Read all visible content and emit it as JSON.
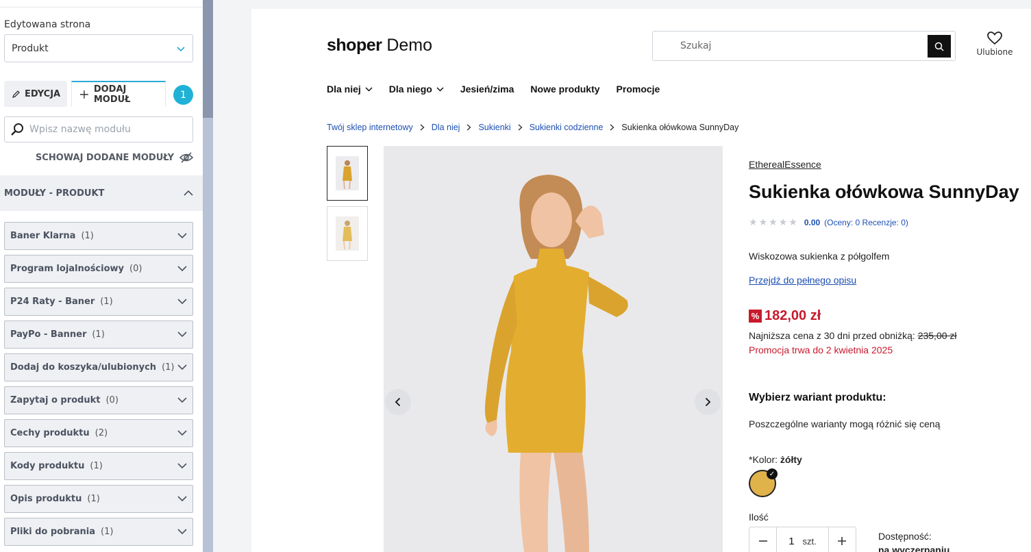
{
  "sidebar": {
    "edited_page_label": "Edytowana strona",
    "edited_page_value": "Produkt",
    "tab_edit": "EDYCJA",
    "tab_add_module": "DODAJ MODUŁ",
    "step_badge": "1",
    "search_placeholder": "Wpisz nazwę modułu",
    "hide_added": "SCHOWAJ DODANE MODUŁY",
    "modules_header": "MODUŁY - PRODUKT",
    "modules": [
      {
        "name": "Baner Klarna",
        "count": "(1)"
      },
      {
        "name": "Program lojalnościowy",
        "count": "(0)"
      },
      {
        "name": "P24 Raty - Baner",
        "count": "(1)"
      },
      {
        "name": "PayPo - Banner",
        "count": "(1)"
      },
      {
        "name": "Dodaj do koszyka/ulubionych",
        "count": "(1)"
      },
      {
        "name": "Zapytaj o produkt",
        "count": "(0)"
      },
      {
        "name": "Cechy produktu",
        "count": "(2)"
      },
      {
        "name": "Kody produktu",
        "count": "(1)"
      },
      {
        "name": "Opis produktu",
        "count": "(1)"
      },
      {
        "name": "Pliki do pobrania",
        "count": "(1)"
      }
    ]
  },
  "shop": {
    "logo_bold": "shoper",
    "logo_rest": "Demo",
    "search_placeholder": "Szukaj",
    "favorites_label": "Ulubione",
    "nav": [
      "Dla niej",
      "Dla niego",
      "Jesień/zima",
      "Nowe produkty",
      "Promocje"
    ],
    "breadcrumbs": [
      "Twój sklep internetowy",
      "Dla niej",
      "Sukienki",
      "Sukienki codzienne",
      "Sukienka ołówkowa SunnyDay"
    ]
  },
  "product": {
    "brand": "EtherealEssence",
    "title": "Sukienka ołówkowa SunnyDay",
    "rating_score": "0.00",
    "rating_counts": "(Oceny: 0 Recenzje: 0)",
    "short_description": "Wiskozowa sukienka z półgolfem",
    "full_description_link": "Przejdź do pełnego opisu",
    "price": "182,00 zł",
    "lowest_price_label": "Najniższa cena z 30 dni przed obniżką:",
    "lowest_price_value": "235,00 zł",
    "promo_until": "Promocja trwa do 2 kwietnia 2025",
    "variant_heading": "Wybierz wariant produktu:",
    "variant_note": "Poszczególne warianty mogą różnić się ceną",
    "color_label": "*Kolor:",
    "color_value": "żółty",
    "quantity_label": "Ilość",
    "quantity_value": "1",
    "quantity_unit": "szt.",
    "availability_label": "Dostępność:",
    "availability_value": "na wyczerpaniu"
  },
  "colors": {
    "accent_blue": "#1c4fb2",
    "promo_red": "#c8192b",
    "swatch_yellow": "#e0b24a",
    "badge_cyan": "#1fb2d6"
  }
}
